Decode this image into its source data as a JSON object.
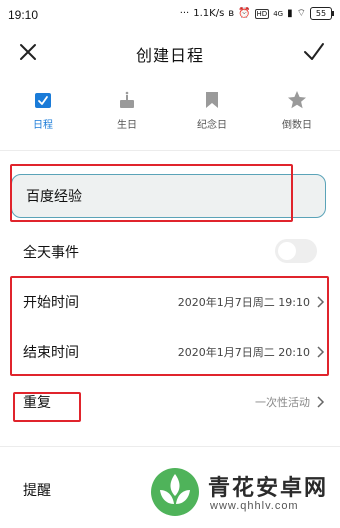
{
  "status_bar": {
    "time": "19:10",
    "network_speed": "1.1K/s",
    "battery": "55",
    "network_type": "4G"
  },
  "header": {
    "title": "创建日程"
  },
  "type_tabs": [
    {
      "label": "日程",
      "icon": "calendar-check-icon",
      "active": true
    },
    {
      "label": "生日",
      "icon": "cake-icon",
      "active": false
    },
    {
      "label": "纪念日",
      "icon": "bookmark-icon",
      "active": false
    },
    {
      "label": "倒数日",
      "icon": "star-icon",
      "active": false
    }
  ],
  "form": {
    "event_name": "百度经验",
    "all_day": {
      "label": "全天事件",
      "enabled": false
    },
    "start": {
      "label": "开始时间",
      "value": "2020年1月7日周二 19:10"
    },
    "end": {
      "label": "结束时间",
      "value": "2020年1月7日周二 20:10"
    },
    "repeat": {
      "label": "重复",
      "value": "一次性活动"
    },
    "reminder": {
      "label": "提醒"
    }
  },
  "watermark": {
    "name": "青花安卓网",
    "url": "www.qhhlv.com"
  },
  "colors": {
    "accent": "#1a7bd8",
    "highlight_box": "#e0242c",
    "input_border": "#5aa3b8",
    "input_bg": "#eef1f1"
  }
}
